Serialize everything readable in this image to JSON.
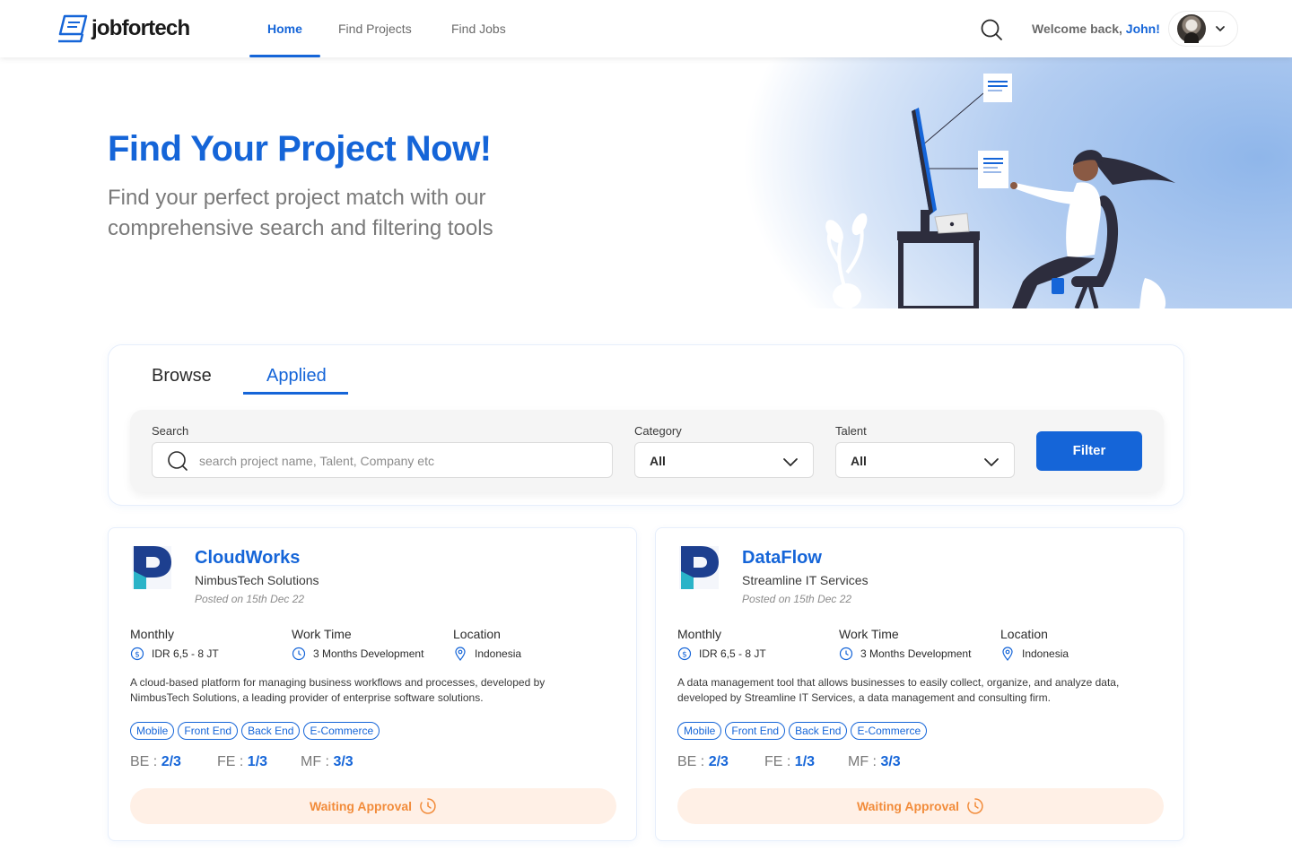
{
  "navbar": {
    "brand": "jobfortech",
    "links": [
      "Home",
      "Find Projects",
      "Find Jobs"
    ],
    "welcome_prefix": "Welcome back, ",
    "user_name": "John",
    "welcome_suffix": "!"
  },
  "hero": {
    "title": "Find Your Project Now!",
    "subtitle": "Find your perfect project match with our comprehensive search and filtering tools"
  },
  "tabs": [
    "Browse",
    "Applied"
  ],
  "filters": {
    "search_label": "Search",
    "search_placeholder": "search project name, Talent, Company etc",
    "category_label": "Category",
    "category_value": "All",
    "talent_label": "Talent",
    "talent_value": "All",
    "filter_button": "Filter"
  },
  "meta_labels": {
    "salary": "Monthly",
    "work_time": "Work Time",
    "location": "Location"
  },
  "projects": [
    {
      "title": "CloudWorks",
      "company": "NimbusTech Solutions",
      "posted": "Posted on 15th Dec 22",
      "salary": "IDR 6,5 - 8 JT",
      "work_time": "3 Months Development",
      "location": "Indonesia",
      "description": "A cloud-based platform for managing business workflows and processes, developed by NimbusTech Solutions, a leading provider of enterprise software solutions.",
      "tags": [
        "Mobile",
        "Front End",
        "Back End",
        "E-Commerce"
      ],
      "quota": {
        "be_label": "BE",
        "be": "2/3",
        "fe_label": "FE",
        "fe": "1/3",
        "mf_label": "MF",
        "mf": "3/3"
      },
      "status": "Waiting Approval"
    },
    {
      "title": "DataFlow",
      "company": "Streamline IT Services",
      "posted": "Posted on 15th Dec 22",
      "salary": "IDR 6,5 - 8 JT",
      "work_time": "3 Months Development",
      "location": "Indonesia",
      "description": "A data management tool that allows businesses to easily collect, organize, and analyze data, developed by Streamline IT Services, a data management and consulting firm.",
      "tags": [
        "Mobile",
        "Front End",
        "Back End",
        "E-Commerce"
      ],
      "quota": {
        "be_label": "BE",
        "be": "2/3",
        "fe_label": "FE",
        "fe": "1/3",
        "mf_label": "MF",
        "mf": "3/3"
      },
      "status": "Waiting Approval"
    }
  ],
  "colors": {
    "primary": "#1565d8",
    "status_text": "#f28c3b",
    "status_bg": "#fff0e6"
  }
}
